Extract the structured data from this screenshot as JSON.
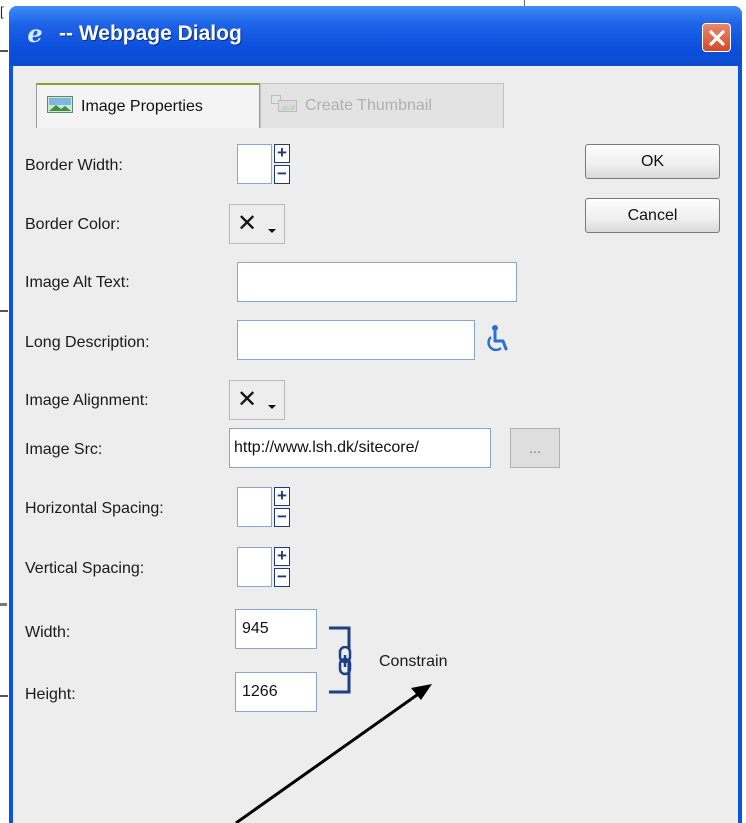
{
  "window": {
    "title": "-- Webpage Dialog",
    "title_icon": "e",
    "close_label": "close"
  },
  "tabs": [
    {
      "label": "Image Properties",
      "active": true
    },
    {
      "label": "Create Thumbnail",
      "active": false
    }
  ],
  "form": {
    "border_width": {
      "label": "Border Width:",
      "value": ""
    },
    "border_color": {
      "label": "Border Color:",
      "glyph": "✕"
    },
    "image_alt_text": {
      "label": "Image Alt Text:",
      "value": ""
    },
    "long_description": {
      "label": "Long Description:",
      "value": ""
    },
    "image_alignment": {
      "label": "Image Alignment:",
      "glyph": "✕"
    },
    "image_src": {
      "label": "Image Src:",
      "value": "http://www.lsh.dk/sitecore/",
      "browse_label": "..."
    },
    "horizontal_spacing": {
      "label": "Horizontal Spacing:",
      "value": ""
    },
    "vertical_spacing": {
      "label": "Vertical Spacing:",
      "value": ""
    },
    "width": {
      "label": "Width:",
      "value": "945"
    },
    "height": {
      "label": "Height:",
      "value": "1266"
    },
    "constrain_label": "Constrain",
    "spin_plus": "+",
    "spin_minus": "−"
  },
  "buttons": {
    "ok": "OK",
    "cancel": "Cancel"
  },
  "colors": {
    "titlebar": "#0b4fdc",
    "dialog_bg": "#ededed",
    "active_tab_accent": "#8aa12a",
    "accessibility_icon": "#2a6fd6",
    "annotation_arrow": "#000000"
  },
  "icons": [
    "ie-logo-icon",
    "close-icon",
    "image-icon",
    "thumbnail-icon",
    "accessibility-icon",
    "chain-link-icon",
    "annotation-arrow"
  ]
}
